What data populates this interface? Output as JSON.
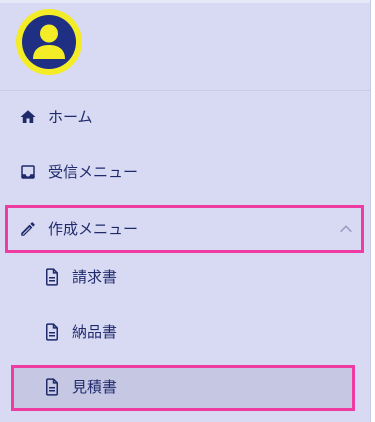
{
  "menu": {
    "home_label": "ホーム",
    "inbox_label": "受信メニュー",
    "create_label": "作成メニュー",
    "create_submenu": {
      "invoice_label": "請求書",
      "delivery_label": "納品書",
      "estimate_label": "見積書"
    }
  },
  "colors": {
    "sidebar_bg": "#d8daf3",
    "text": "#1f2a6b",
    "highlight": "#ef3ca2",
    "avatar_bg": "#f3ec26",
    "selected_bg": "#c5c7e3"
  },
  "icons": {
    "avatar": "user-avatar-icon",
    "home": "home-icon",
    "inbox": "inbox-icon",
    "create": "pencil-icon",
    "document": "document-icon",
    "expand": "chevron-up-icon"
  },
  "state": {
    "create_menu_expanded": true,
    "selected_item": "見積書"
  }
}
